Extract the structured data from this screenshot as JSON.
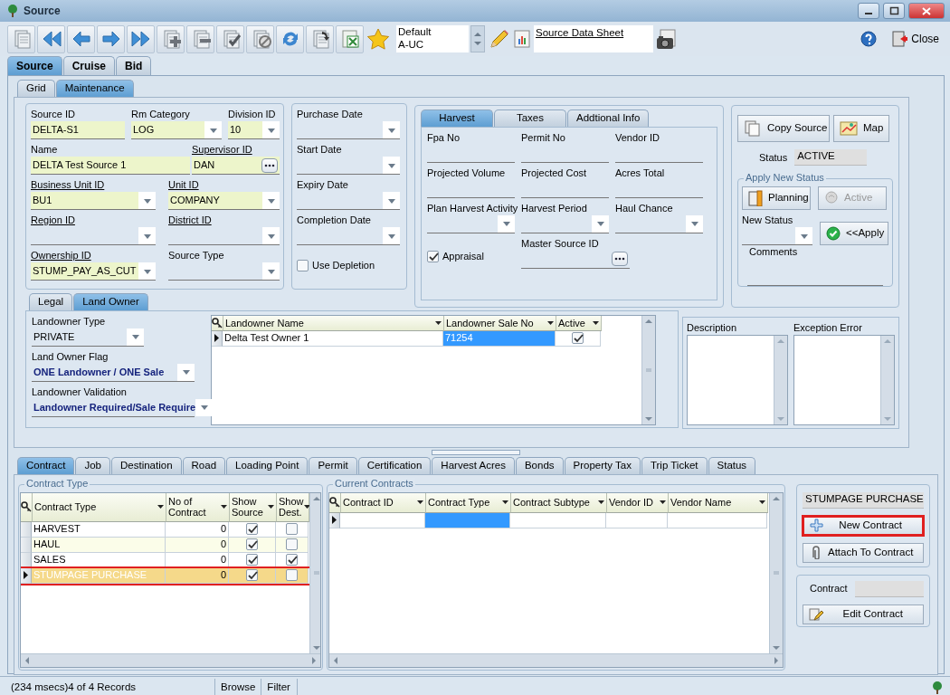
{
  "window": {
    "title": "Source"
  },
  "toolbar": {
    "layouts": [
      "Default",
      "A-UC"
    ],
    "report": "Source Data Sheet",
    "close": "Close"
  },
  "main_tabs": [
    {
      "label": "Source",
      "selected": true
    },
    {
      "label": "Cruise",
      "selected": false
    },
    {
      "label": "Bid",
      "selected": false
    }
  ],
  "view_tabs": [
    {
      "label": "Grid",
      "selected": false
    },
    {
      "label": "Maintenance",
      "selected": true
    }
  ],
  "general": {
    "fields": [
      {
        "label": "Source ID",
        "kind": "text",
        "value": "DELTA-S1",
        "required": true,
        "link": false
      },
      {
        "label": "Rm Category",
        "kind": "combo",
        "value": "LOG",
        "required": true,
        "link": false
      },
      {
        "label": "Division ID",
        "kind": "combo",
        "value": "10",
        "required": true,
        "link": false
      },
      {
        "label": "Name",
        "kind": "text",
        "value": "DELTA Test Source 1",
        "required": true,
        "link": false
      },
      {
        "label": "Supervisor ID",
        "kind": "lookup",
        "value": "DAN",
        "required": true,
        "link": true
      },
      {
        "label": "Business Unit ID",
        "kind": "combo",
        "value": "BU1",
        "required": true,
        "link": true
      },
      {
        "label": "Unit ID",
        "kind": "combo",
        "value": "COMPANY",
        "required": true,
        "link": true
      },
      {
        "label": "Region ID",
        "kind": "combo",
        "required": false,
        "link": true
      },
      {
        "label": "District ID",
        "kind": "combo",
        "required": false,
        "link": true
      },
      {
        "label": "Ownership ID",
        "kind": "combo",
        "value": "STUMP_PAY_AS_CUT",
        "required": true,
        "link": true
      },
      {
        "label": "Source Type",
        "kind": "combo",
        "required": false,
        "link": false
      }
    ]
  },
  "dates": {
    "fields": [
      {
        "label": "Purchase Date",
        "kind": "combo",
        "required": false,
        "link": false
      },
      {
        "label": "Start Date",
        "kind": "combo",
        "required": false,
        "link": false
      },
      {
        "label": "Expiry Date",
        "kind": "combo",
        "required": false,
        "link": false
      },
      {
        "label": "Completion Date",
        "kind": "combo",
        "required": false,
        "link": false
      }
    ],
    "use_depletion": {
      "label": "Use Depletion",
      "checked": false
    }
  },
  "harvest": {
    "tabs": [
      {
        "label": "Harvest",
        "selected": true
      },
      {
        "label": "Taxes",
        "selected": false
      },
      {
        "label": "Addtional Info",
        "selected": false
      }
    ],
    "fields": [
      {
        "label": "Fpa No",
        "kind": "text",
        "required": false,
        "link": false
      },
      {
        "label": "Permit No",
        "kind": "text",
        "required": false,
        "link": false
      },
      {
        "label": "Vendor ID",
        "kind": "text",
        "required": false,
        "link": false
      },
      {
        "label": "Projected Volume",
        "kind": "text",
        "required": false,
        "link": false
      },
      {
        "label": "Projected Cost",
        "kind": "text",
        "required": false,
        "link": false
      },
      {
        "label": "Acres Total",
        "kind": "text",
        "required": false,
        "link": false
      },
      {
        "label": "Plan Harvest Activity",
        "kind": "combo",
        "required": false,
        "link": false
      },
      {
        "label": "Harvest Period",
        "kind": "combo",
        "required": false,
        "link": false
      },
      {
        "label": "Haul Chance",
        "kind": "combo",
        "required": false,
        "link": false
      },
      {
        "label": "Appraisal",
        "kind": "checkbox",
        "checked": true
      },
      {
        "label": "Master Source ID",
        "kind": "lookup",
        "required": false,
        "link": false
      }
    ]
  },
  "actions": {
    "buttons": [
      "Copy Source",
      "Map"
    ],
    "status_label": "Status",
    "status": "ACTIVE",
    "apply_group": {
      "title": "Apply New Status",
      "buttons": [
        {
          "label": "Planning",
          "disabled": false
        },
        {
          "label": "Active",
          "disabled": true
        }
      ],
      "new_status_label": "New Status",
      "apply": "<<Apply",
      "comments_label": "Comments"
    }
  },
  "land_tabs": [
    {
      "label": "Legal",
      "selected": false
    },
    {
      "label": "Land Owner",
      "selected": true
    }
  ],
  "landowner": {
    "fields": [
      {
        "label": "Landowner Type",
        "value": "PRIVATE",
        "bold": false
      },
      {
        "label": "Land Owner Flag",
        "value": "ONE Landowner / ONE Sale",
        "bold": true
      },
      {
        "label": "Landowner Validation",
        "value": "Landowner Required/Sale Require",
        "bold": true
      }
    ],
    "grid": {
      "columns": [
        {
          "label": "Landowner Name",
          "kind": "text"
        },
        {
          "label": "Landowner Sale No",
          "kind": "text"
        },
        {
          "label": "Active",
          "kind": "check"
        }
      ],
      "rows": [
        {
          "selected": true,
          "cells": [
            {
              "text": "Delta Test Owner 1",
              "focused": false
            },
            {
              "text": "71254",
              "focused": true
            },
            {
              "checked": true
            }
          ]
        }
      ]
    }
  },
  "notes": [
    "Description",
    "Exception Error"
  ],
  "detail_tabs": [
    {
      "label": "Contract",
      "selected": true
    },
    {
      "label": "Job",
      "selected": false
    },
    {
      "label": "Destination",
      "selected": false
    },
    {
      "label": "Road",
      "selected": false
    },
    {
      "label": "Loading Point",
      "selected": false
    },
    {
      "label": "Permit",
      "selected": false
    },
    {
      "label": "Certification",
      "selected": false
    },
    {
      "label": "Harvest Acres",
      "selected": false
    },
    {
      "label": "Bonds",
      "selected": false
    },
    {
      "label": "Property Tax",
      "selected": false
    },
    {
      "label": "Trip Ticket",
      "selected": false
    },
    {
      "label": "Status",
      "selected": false
    }
  ],
  "contract_types": {
    "title": "Contract Type",
    "columns": [
      {
        "label": "Contract Type",
        "kind": "text"
      },
      {
        "label": "No of Contract",
        "kind": "number"
      },
      {
        "label": "Show Source",
        "kind": "check"
      },
      {
        "label": "Show Dest.",
        "kind": "check"
      }
    ],
    "rows": [
      {
        "selected": false,
        "highlighted": false,
        "cells": [
          {
            "text": "HARVEST",
            "focused": false
          },
          {
            "text": "0",
            "focused": false
          },
          {
            "checked": true
          },
          {
            "checked": false
          }
        ]
      },
      {
        "selected": false,
        "highlighted": false,
        "cells": [
          {
            "text": "HAUL",
            "focused": false
          },
          {
            "text": "0",
            "focused": false
          },
          {
            "checked": true
          },
          {
            "checked": false
          }
        ]
      },
      {
        "selected": false,
        "highlighted": false,
        "cells": [
          {
            "text": "SALES",
            "focused": false
          },
          {
            "text": "0",
            "focused": false
          },
          {
            "checked": true
          },
          {
            "checked": true
          }
        ]
      },
      {
        "selected": true,
        "highlighted": true,
        "cells": [
          {
            "text": "STUMPAGE PURCHASE",
            "focused": true
          },
          {
            "text": "0",
            "focused": false
          },
          {
            "checked": true
          },
          {
            "checked": false
          }
        ]
      }
    ]
  },
  "current_contracts": {
    "title": "Current Contracts",
    "columns": [
      {
        "label": "Contract ID"
      },
      {
        "label": "Contract Type"
      },
      {
        "label": "Contract Subtype"
      },
      {
        "label": "Vendor ID"
      },
      {
        "label": "Vendor Name"
      }
    ],
    "rows": [
      {
        "selected": true,
        "cells": [
          {
            "focused": false
          },
          {
            "focused": true
          },
          {
            "focused": false
          },
          {
            "focused": false
          },
          {
            "focused": false
          }
        ]
      }
    ]
  },
  "contract_panel": {
    "selected_type": "STUMPAGE PURCHASE",
    "buttons": [
      {
        "label": "New Contract",
        "highlighted": true
      },
      {
        "label": "Attach To Contract",
        "highlighted": false
      }
    ],
    "contract_label": "Contract",
    "edit": "Edit Contract"
  },
  "status_bar": [
    "(234 msecs)4 of 4 Records",
    "Browse",
    "Filter"
  ]
}
